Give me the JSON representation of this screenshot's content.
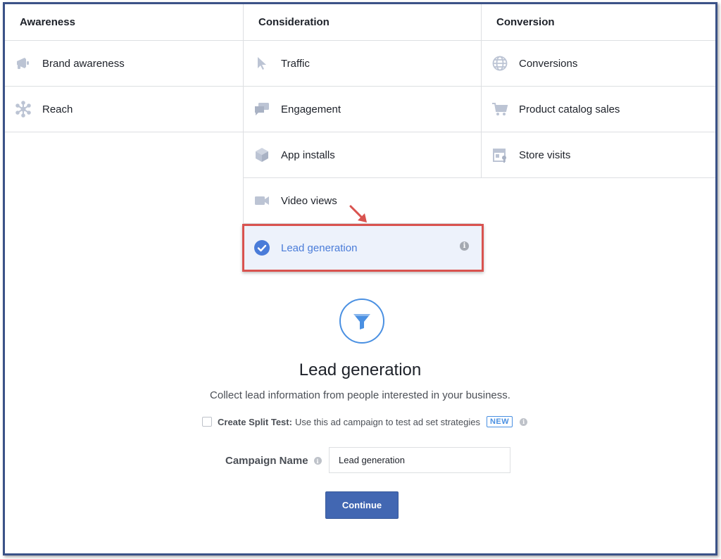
{
  "columns": [
    {
      "title": "Awareness",
      "items": [
        {
          "label": "Brand awareness",
          "icon": "megaphone-icon"
        },
        {
          "label": "Reach",
          "icon": "reach-icon"
        }
      ]
    },
    {
      "title": "Consideration",
      "items": [
        {
          "label": "Traffic",
          "icon": "cursor-icon"
        },
        {
          "label": "Engagement",
          "icon": "chat-bubbles-icon"
        },
        {
          "label": "App installs",
          "icon": "box-icon"
        },
        {
          "label": "Video views",
          "icon": "video-camera-icon"
        },
        {
          "label": "Lead generation",
          "icon": "checkmark-icon",
          "selected": true
        }
      ]
    },
    {
      "title": "Conversion",
      "items": [
        {
          "label": "Conversions",
          "icon": "globe-icon"
        },
        {
          "label": "Product catalog sales",
          "icon": "shopping-cart-icon"
        },
        {
          "label": "Store visits",
          "icon": "store-icon"
        }
      ]
    }
  ],
  "detail": {
    "icon": "funnel-icon",
    "title": "Lead generation",
    "description": "Collect lead information from people interested in your business."
  },
  "split_test": {
    "label": "Create Split Test:",
    "text": "Use this ad campaign to test ad set strategies",
    "badge": "NEW",
    "checked": false
  },
  "campaign": {
    "label": "Campaign Name",
    "value": "Lead generation"
  },
  "continue_label": "Continue",
  "colors": {
    "accent": "#4a7cd9",
    "selection_border": "#d9534f",
    "button": "#4267b2",
    "frame": "#3b5287"
  }
}
